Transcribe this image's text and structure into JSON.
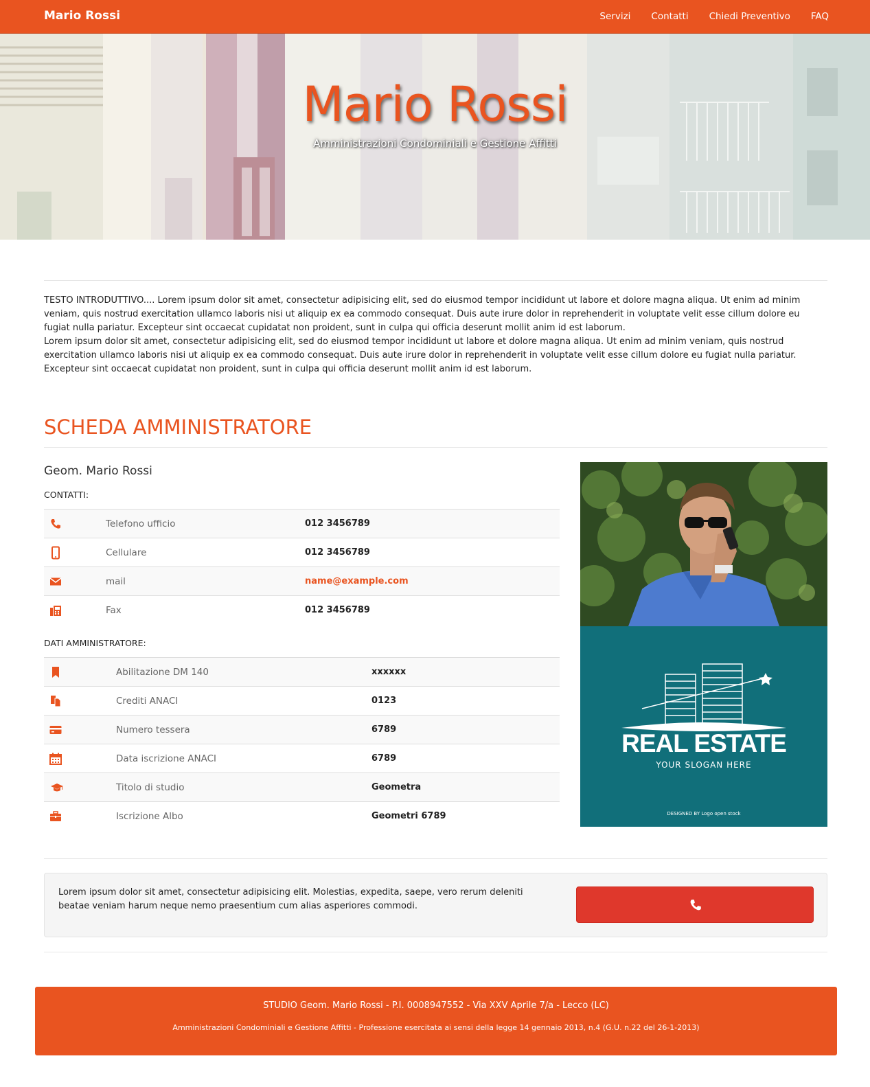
{
  "navbar": {
    "brand": "Mario Rossi",
    "links": [
      "Servizi",
      "Contatti",
      "Chiedi Preventivo",
      "FAQ"
    ]
  },
  "hero": {
    "title": "Mario Rossi",
    "subtitle": "Amministrazioni Condominiali e Gestione Affitti"
  },
  "intro": {
    "p1": "TESTO INTRODUTTIVO.... Lorem ipsum dolor sit amet, consectetur adipisicing elit, sed do eiusmod tempor incididunt ut labore et dolore magna aliqua. Ut enim ad minim veniam, quis nostrud exercitation ullamco laboris nisi ut aliquip ex ea commodo consequat. Duis aute irure dolor in reprehenderit in voluptate velit esse cillum dolore eu fugiat nulla pariatur. Excepteur sint occaecat cupidatat non proident, sunt in culpa qui officia deserunt mollit anim id est laborum.",
    "p2": "Lorem ipsum dolor sit amet, consectetur adipisicing elit, sed do eiusmod tempor incididunt ut labore et dolore magna aliqua. Ut enim ad minim veniam, quis nostrud exercitation ullamco laboris nisi ut aliquip ex ea commodo consequat. Duis aute irure dolor in reprehenderit in voluptate velit esse cillum dolore eu fugiat nulla pariatur. Excepteur sint occaecat cupidatat non proident, sunt in culpa qui officia deserunt mollit anim id est laborum."
  },
  "scheda": {
    "title": "SCHEDA AMMINISTRATORE",
    "name": "Geom. Mario Rossi",
    "contacts_label": "CONTATTI:",
    "contacts": [
      {
        "icon": "phone-icon",
        "label": "Telefono ufficio",
        "value": "012 3456789"
      },
      {
        "icon": "mobile-icon",
        "label": "Cellulare",
        "value": "012 3456789"
      },
      {
        "icon": "envelope-icon",
        "label": "mail",
        "value": "name@example.com"
      },
      {
        "icon": "fax-icon",
        "label": "Fax",
        "value": "012 3456789"
      }
    ],
    "dati_label": "DATI AMMINISTRATORE:",
    "dati": [
      {
        "icon": "bookmark-icon",
        "label": "Abilitazione DM 140",
        "value": "xxxxxx"
      },
      {
        "icon": "copy-icon",
        "label": "Crediti ANACI",
        "value": "0123"
      },
      {
        "icon": "credit-card-icon",
        "label": "Numero tessera",
        "value": "6789"
      },
      {
        "icon": "calendar-icon",
        "label": "Data iscrizione ANACI",
        "value": "6789"
      },
      {
        "icon": "graduation-cap-icon",
        "label": "Titolo di studio",
        "value": "Geometra"
      },
      {
        "icon": "briefcase-icon",
        "label": "Iscrizione Albo",
        "value": "Geometri 6789"
      }
    ]
  },
  "logo": {
    "title": "REAL ESTATE",
    "slogan": "YOUR SLOGAN HERE",
    "credit": "DESIGNED BY Logo open stock"
  },
  "cta": {
    "text": "Lorem ipsum dolor sit amet, consectetur adipisicing elit. Molestias, expedita, saepe, vero rerum deleniti beatae veniam harum neque nemo praesentium cum alias asperiores commodi."
  },
  "footer": {
    "line1": "STUDIO Geom. Mario Rossi - P.I. 0008947552 - Via XXV Aprile 7/a - Lecco (LC)",
    "line2": "Amministrazioni Condominiali e Gestione Affitti - Professione esercitata ai sensi della legge 14 gennaio 2013, n.4 (G.U. n.22 del 26-1-2013)"
  },
  "colors": {
    "accent": "#e95420",
    "button": "#df382c",
    "logo_bg": "#116f7a"
  }
}
